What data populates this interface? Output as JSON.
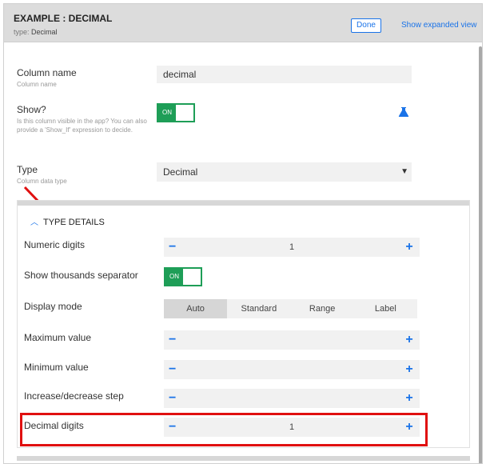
{
  "header": {
    "title": "EXAMPLE : DECIMAL",
    "subtitle_prefix": "type:",
    "subtitle_value": "Decimal",
    "done_label": "Done",
    "expand_label": "Show expanded view"
  },
  "fields": {
    "column_name": {
      "label": "Column name",
      "help": "Column name",
      "value": "decimal"
    },
    "show": {
      "label": "Show?",
      "help": "Is this column visible in the app? You can also provide a 'Show_If' expression to decide.",
      "toggle_text": "ON"
    },
    "type": {
      "label": "Type",
      "help": "Column data type",
      "value": "Decimal"
    }
  },
  "type_details": {
    "title": "TYPE DETAILS",
    "numeric_digits": {
      "label": "Numeric digits",
      "value": "1"
    },
    "thousands": {
      "label": "Show thousands separator",
      "toggle_text": "ON"
    },
    "display_mode": {
      "label": "Display mode",
      "options": [
        "Auto",
        "Standard",
        "Range",
        "Label"
      ],
      "selected": "Auto"
    },
    "max_value": {
      "label": "Maximum value",
      "value": ""
    },
    "min_value": {
      "label": "Minimum value",
      "value": ""
    },
    "step": {
      "label": "Increase/decrease step",
      "value": ""
    },
    "decimal_digits": {
      "label": "Decimal digits",
      "value": "1"
    }
  },
  "icons": {
    "flask": "flask-icon",
    "collapse": "chevron-up-icon",
    "minus": "minus-icon",
    "plus": "plus-icon",
    "annotation": "red-arrow"
  },
  "colors": {
    "accent": "#1a73e8",
    "toggle_green": "#1e9e57",
    "highlight_red": "#e01010"
  }
}
